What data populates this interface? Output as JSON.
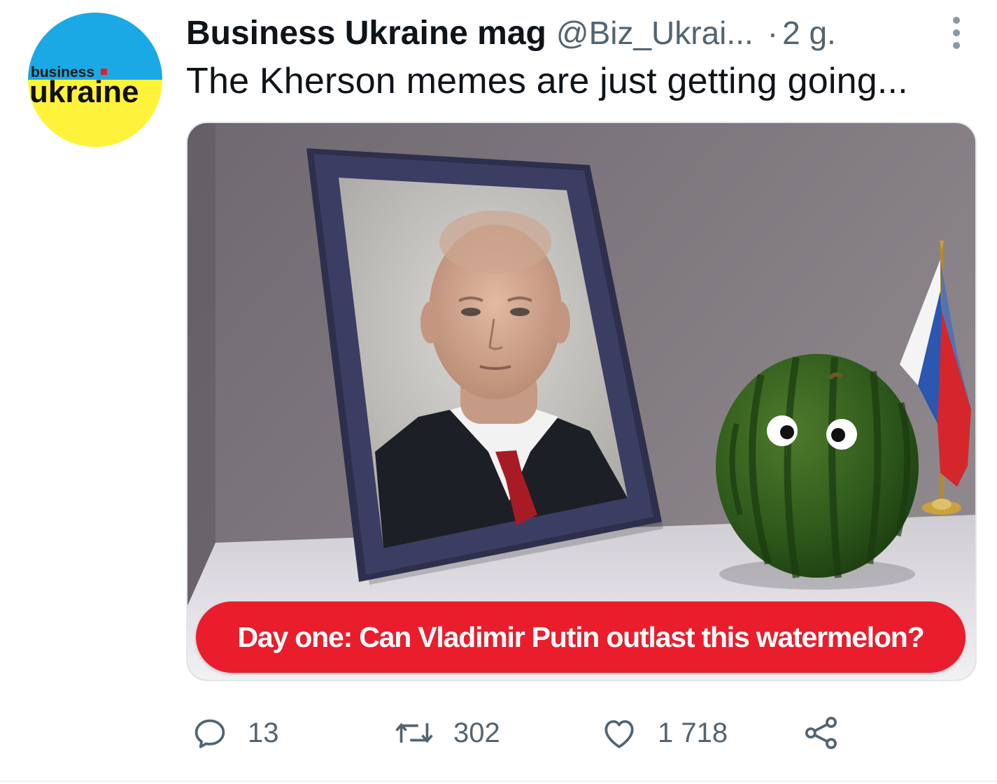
{
  "tweet": {
    "author": {
      "display_name": "Business Ukraine mag",
      "handle": "@Biz_Ukrai...",
      "avatar_text_top": "business",
      "avatar_text_bottom": "ukraine"
    },
    "separator": "·",
    "time": "2 g.",
    "text": "The Kherson memes are just getting going...",
    "media": {
      "caption": "Day one: Can Vladimir Putin outlast this watermelon?"
    },
    "actions": {
      "replies": "13",
      "retweets": "302",
      "likes": "1 718"
    }
  },
  "colors": {
    "caption_red": "#ea1d2c",
    "secondary_text": "#536471",
    "avatar_blue": "#1aa9e4",
    "avatar_yellow": "#fff23a"
  },
  "icons": [
    "more-icon",
    "reply-icon",
    "retweet-icon",
    "like-icon",
    "share-icon"
  ]
}
